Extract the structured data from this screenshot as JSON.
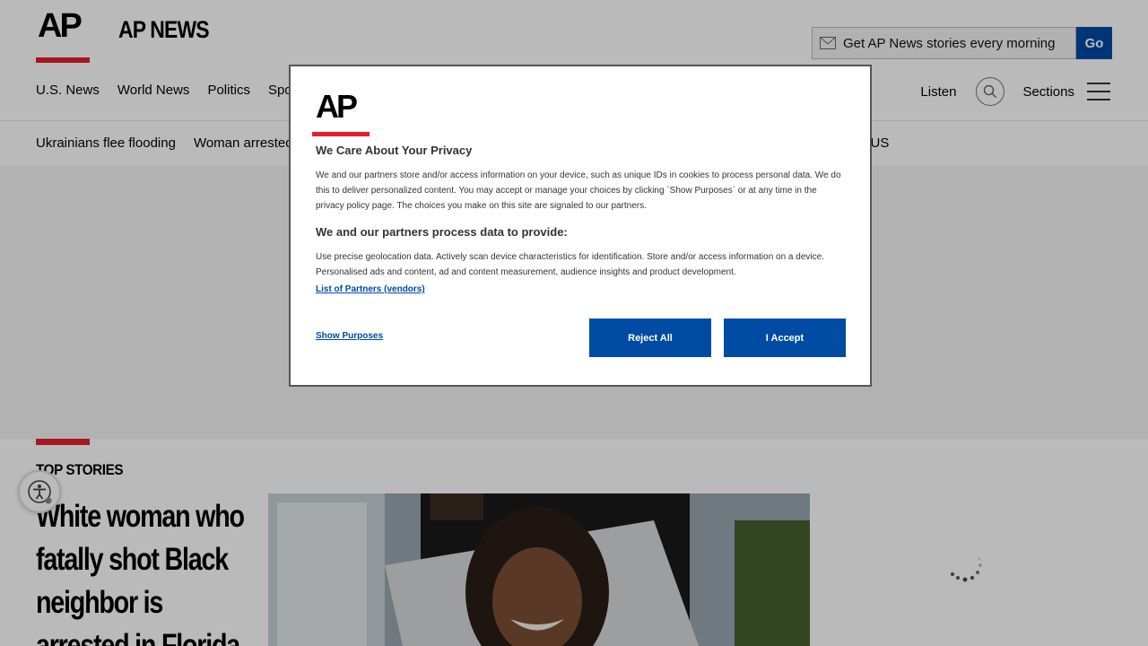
{
  "brand": {
    "logo_text": "AP",
    "site_name": "AP NEWS"
  },
  "newsletter": {
    "placeholder": "Get AP News stories every morning",
    "button_label": "Go"
  },
  "nav": {
    "items": [
      "U.S. News",
      "World News",
      "Politics",
      "Sports"
    ],
    "listen_label": "Listen",
    "sections_label": "Sections"
  },
  "trending": {
    "items": [
      "Ukrainians flee flooding",
      "Woman arrested"
    ],
    "tail": "o US"
  },
  "top_stories": {
    "label": "TOP STORIES",
    "headline": "White woman who fatally shot Black neighbor is arrested in Florida"
  },
  "consent": {
    "logo_text": "AP",
    "title": "We Care About Your Privacy",
    "body": "We and our partners store and/or access information on your device, such as unique IDs in cookies to process personal data. We do this to deliver personalized content. You may accept or manage your choices by clicking `Show Purposes` or at any time in the privacy policy page. The choices you make on this site are signaled to our partners.",
    "subtitle": "We and our partners process data to provide:",
    "purposes": "Use precise geolocation data. Actively scan device characteristics for identification. Store and/or access information on a device. Personalised ads and content, ad and content measurement, audience insights and product development.",
    "partners_link": "List of Partners (vendors)",
    "show_purposes": "Show Purposes",
    "reject_label": "Reject All",
    "accept_label": "I Accept"
  },
  "colors": {
    "accent_red": "#e4202e",
    "brand_blue": "#004ba4"
  }
}
